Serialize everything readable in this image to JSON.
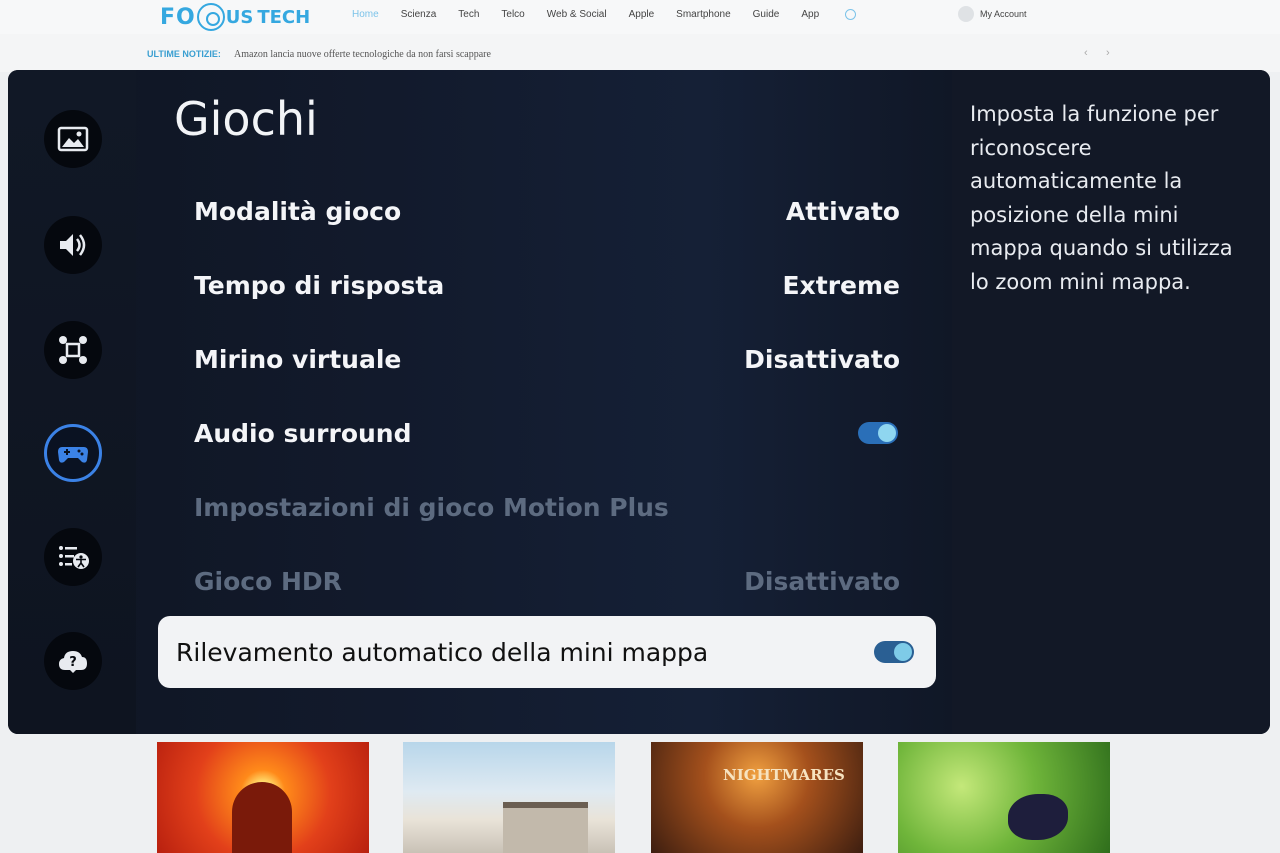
{
  "site": {
    "logo": {
      "part1": "FO",
      "part2": "US",
      "part3": "TECH"
    },
    "nav": [
      "Home",
      "Scienza",
      "Tech",
      "Telco",
      "Web & Social",
      "Apple",
      "Smartphone",
      "Guide",
      "App"
    ],
    "account": "My Account",
    "ticker_label": "ULTIME NOTIZIE:",
    "ticker_text": "Amazon lancia nuove offerte tecnologiche da non farsi scappare",
    "ticker_prev": "‹",
    "ticker_next": "›"
  },
  "tv": {
    "title": "Giochi",
    "rail_icons": [
      "picture-icon",
      "sound-icon",
      "connection-icon",
      "gamepad-icon",
      "accessibility-icon",
      "support-icon"
    ],
    "settings": [
      {
        "label": "Modalità gioco",
        "value": "Attivato"
      },
      {
        "label": "Tempo di risposta",
        "value": "Extreme"
      },
      {
        "label": "Mirino virtuale",
        "value": "Disattivato"
      },
      {
        "label": "Audio surround",
        "value": ""
      },
      {
        "label": "Impostazioni di gioco Motion Plus",
        "value": ""
      },
      {
        "label": "Gioco HDR",
        "value": "Disattivato"
      }
    ],
    "focused": {
      "label": "Rilevamento automatico della mini mappa"
    },
    "help": "Imposta la funzione per riconoscere automaticamente la posizione della mini mappa quando si utilizza lo zoom mini mappa."
  },
  "thumbs": {
    "t3_text": "NIGHTMARES"
  },
  "colors": {
    "accent": "#3b82e6",
    "toggle_on": "#2a6fb8",
    "site_blue": "#35a8e0"
  }
}
